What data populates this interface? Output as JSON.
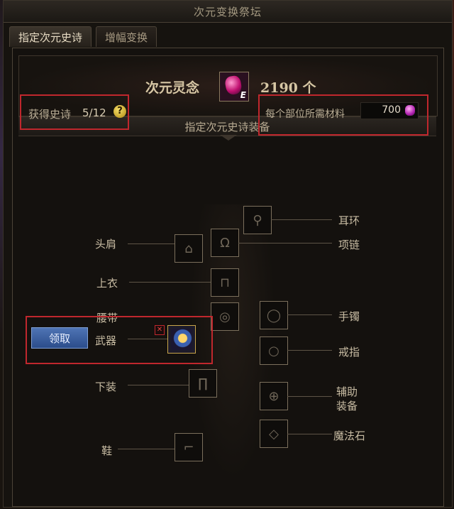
{
  "window": {
    "title": "次元变换祭坛"
  },
  "tabs": [
    {
      "label": "指定次元史诗",
      "active": true
    },
    {
      "label": "增幅变换",
      "active": false
    }
  ],
  "currency": {
    "label": "次元灵念",
    "icon": "dimension-spirit-gem-icon",
    "icon_letter": "E",
    "count": "2190 个"
  },
  "section": {
    "title": "指定次元史诗装备"
  },
  "epic_obtained": {
    "label": "获得史诗",
    "value": "5/12",
    "help_glyph": "?"
  },
  "material": {
    "label": "每个部位所需材料",
    "value": "700"
  },
  "slots": {
    "shoulder": "头肩",
    "top": "上衣",
    "belt": "腰带",
    "weapon": "武器",
    "pants": "下装",
    "shoes": "鞋",
    "earring": "耳环",
    "necklace": "项链",
    "bracelet": "手镯",
    "ring": "戒指",
    "subequip_1": "辅助",
    "subequip_2": "装备",
    "magicstone": "魔法石"
  },
  "claim_button": "领取",
  "remove_glyph": "✕",
  "colors": {
    "highlight": "#c0272d",
    "claim_button": "#3b5f9e",
    "weapon_frame": "#c9a64a"
  }
}
